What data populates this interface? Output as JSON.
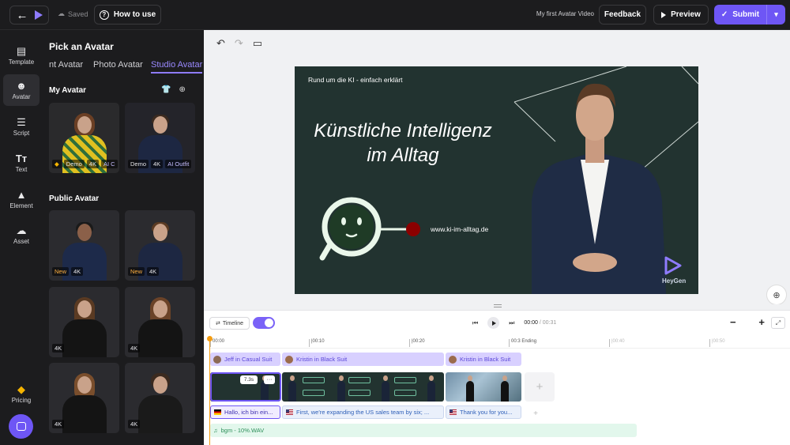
{
  "topbar": {
    "saved_label": "Saved",
    "howto_label": "How to use",
    "video_title": "My first Avatar Video",
    "feedback_label": "Feedback",
    "preview_label": "Preview",
    "submit_label": "Submit"
  },
  "rail": {
    "items": [
      {
        "label": "Template",
        "icon": "template-icon"
      },
      {
        "label": "Avatar",
        "icon": "avatar-icon",
        "active": true
      },
      {
        "label": "Script",
        "icon": "script-icon"
      },
      {
        "label": "Text",
        "icon": "text-icon",
        "glyph": "Tт"
      },
      {
        "label": "Element",
        "icon": "element-icon"
      },
      {
        "label": "Asset",
        "icon": "asset-icon"
      }
    ],
    "pricing_label": "Pricing"
  },
  "panel": {
    "title": "Pick an Avatar",
    "tabs": [
      "nt Avatar",
      "Photo Avatar",
      "Studio Avatar"
    ],
    "active_tab": "Studio Avatar",
    "my_avatar_title": "My Avatar",
    "public_avatar_title": "Public Avatar",
    "my_avatars": [
      {
        "badges": [
          "Demo",
          "4K",
          "AI C"
        ]
      },
      {
        "badges": [
          "Demo",
          "4K",
          "AI Outfit"
        ]
      }
    ],
    "public_avatars": [
      {
        "badges": [
          "New",
          "4K"
        ]
      },
      {
        "badges": [
          "New",
          "4K"
        ]
      },
      {
        "badges": [
          "4K"
        ]
      },
      {
        "badges": [
          "4K"
        ]
      },
      {
        "badges": [
          "4K"
        ]
      },
      {
        "badges": [
          "4K"
        ]
      }
    ]
  },
  "slide": {
    "top_text": "Rund um die KI - einfach erklärt",
    "heading_line1": "Künstliche Intelligenz",
    "heading_line2": "im Alltag",
    "url": "www.ki-im-alltag.de",
    "brand": "HeyGen",
    "colors": {
      "background": "#223330",
      "logo": "#eaf7ea",
      "dot": "#8b0000"
    }
  },
  "timeline": {
    "timeline_label": "Timeline",
    "current_time": "00:00",
    "total_time": "/ 00:31",
    "ruler": [
      {
        "label": "00:00"
      },
      {
        "label": "|00:10"
      },
      {
        "label": "|00:20"
      },
      {
        "label": "00:3 Ending"
      },
      {
        "label": "|00:40"
      },
      {
        "label": "|00:50"
      }
    ],
    "avatar_track": [
      "Jeff in Casual Suit",
      "Kristin in Black Suit",
      "Kristin in Black Suit"
    ],
    "scene_duration": "7.3s",
    "script_track": [
      {
        "text": "Hallo, ich bin ein...",
        "flag": "de"
      },
      {
        "text": "First, we're expanding the US sales team by six; ...",
        "flag": "us"
      },
      {
        "text": "Thank you for you...",
        "flag": "us"
      }
    ],
    "audio_track": "bgm - 10%.WAV"
  },
  "accent_color": "#6e56f5"
}
